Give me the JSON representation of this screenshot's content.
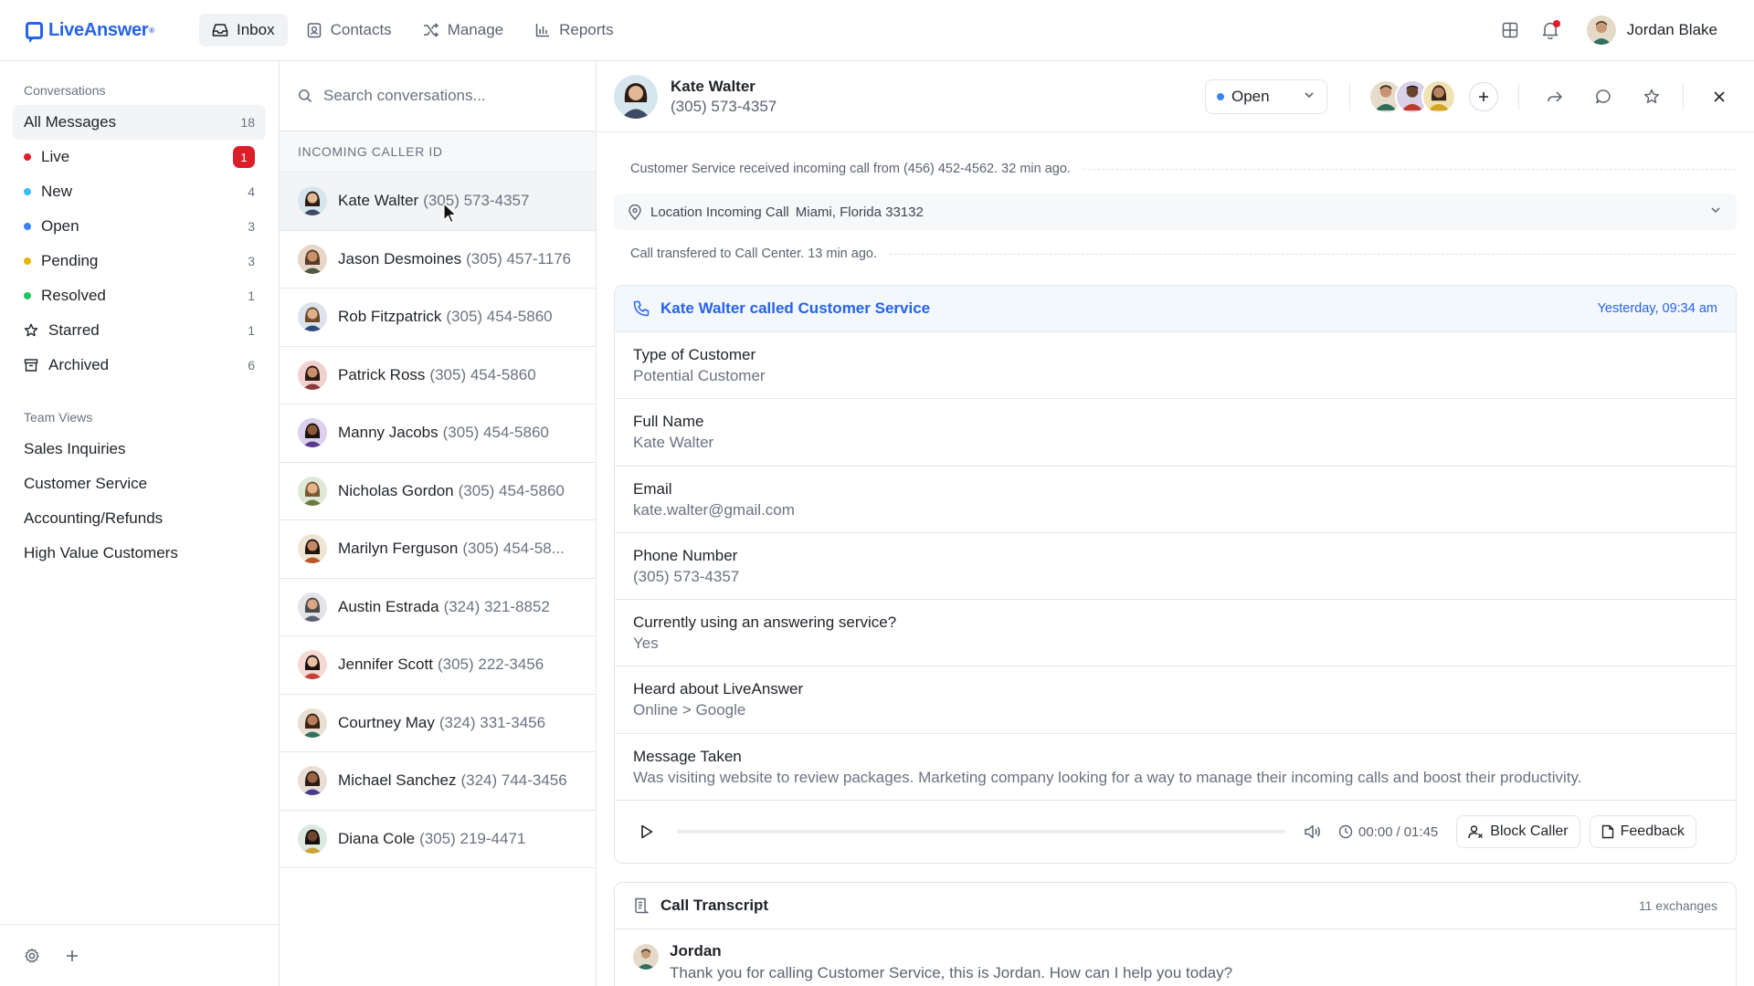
{
  "app": {
    "logo_text": "LiveAnswer",
    "logo_mark": "®",
    "brand_color": "#2563eb"
  },
  "topnav": {
    "items": [
      {
        "label": "Inbox",
        "icon": "inbox-icon",
        "active": true
      },
      {
        "label": "Contacts",
        "icon": "contacts-icon",
        "active": false
      },
      {
        "label": "Manage",
        "icon": "shuffle-icon",
        "active": false
      },
      {
        "label": "Reports",
        "icon": "bar-chart-icon",
        "active": false
      }
    ],
    "user_name": "Jordan Blake"
  },
  "sidebar": {
    "section_conversations": "Conversations",
    "items": [
      {
        "label": "All Messages",
        "count": "18"
      },
      {
        "label": "Live",
        "count": "1",
        "dot": "#e11d2e"
      },
      {
        "label": "New",
        "count": "4",
        "dot": "#38bdf8"
      },
      {
        "label": "Open",
        "count": "3",
        "dot": "#3b82f6"
      },
      {
        "label": "Pending",
        "count": "3",
        "dot": "#eab308"
      },
      {
        "label": "Resolved",
        "count": "1",
        "dot": "#22c55e"
      },
      {
        "label": "Starred",
        "count": "1",
        "icon": "star-icon"
      },
      {
        "label": "Archived",
        "count": "6",
        "icon": "archive-icon"
      }
    ],
    "section_team": "Team Views",
    "team_items": [
      "Sales Inquiries",
      "Customer Service",
      "Accounting/Refunds",
      "High Value Customers"
    ]
  },
  "convlist": {
    "search_placeholder": "Search conversations...",
    "header": "INCOMING CALLER ID",
    "items": [
      {
        "name": "Kate Walter",
        "phone": "(305) 573-4357"
      },
      {
        "name": "Jason Desmoines",
        "phone": "(305) 457-1176"
      },
      {
        "name": "Rob Fitzpatrick",
        "phone": "(305) 454-5860"
      },
      {
        "name": "Patrick Ross",
        "phone": "(305) 454-5860"
      },
      {
        "name": "Manny Jacobs",
        "phone": "(305) 454-5860"
      },
      {
        "name": "Nicholas Gordon",
        "phone": "(305) 454-5860"
      },
      {
        "name": "Marilyn Ferguson",
        "phone": "(305) 454-58..."
      },
      {
        "name": "Austin Estrada",
        "phone": "(324) 321-8852"
      },
      {
        "name": "Jennifer Scott",
        "phone": "(305) 222-3456"
      },
      {
        "name": "Courtney May",
        "phone": "(324) 331-3456"
      },
      {
        "name": "Michael Sanchez",
        "phone": "(324) 744-3456"
      },
      {
        "name": "Diana Cole",
        "phone": "(305) 219-4471"
      }
    ]
  },
  "detail": {
    "contact_name": "Kate Walter",
    "contact_phone": "(305) 573-4357",
    "status": "Open",
    "activity_1": "Customer Service received incoming call from (456) 452-4562. 32 min ago.",
    "location_label": "Location Incoming Call",
    "location_value": "Miami, Florida 33132",
    "activity_2": "Call transfered to Call Center. 13 min ago.",
    "card_title": "Kate Walter called Customer Service",
    "card_time": "Yesterday, 09:34 am",
    "fields": [
      {
        "key": "Type of Customer",
        "value": "Potential Customer"
      },
      {
        "key": "Full Name",
        "value": "Kate Walter"
      },
      {
        "key": "Email",
        "value": "kate.walter@gmail.com"
      },
      {
        "key": "Phone Number",
        "value": "(305) 573-4357"
      },
      {
        "key": "Currently using an answering service?",
        "value": "Yes"
      },
      {
        "key": "Heard about LiveAnswer",
        "value": "Online > Google"
      },
      {
        "key": "Message Taken",
        "value": "Was visiting website to review packages. Marketing company looking for a way to manage their incoming calls and boost their productivity."
      }
    ],
    "player": {
      "current": "00:00",
      "separator": "/",
      "total": "01:45",
      "progress": 0
    },
    "block_label": "Block Caller",
    "feedback_label": "Feedback",
    "transcript_title": "Call Transcript",
    "transcript_count": "11 exchanges",
    "transcript_speaker": "Jordan",
    "transcript_text": "Thank you for calling Customer Service, this is Jordan. How can I help you today?"
  }
}
